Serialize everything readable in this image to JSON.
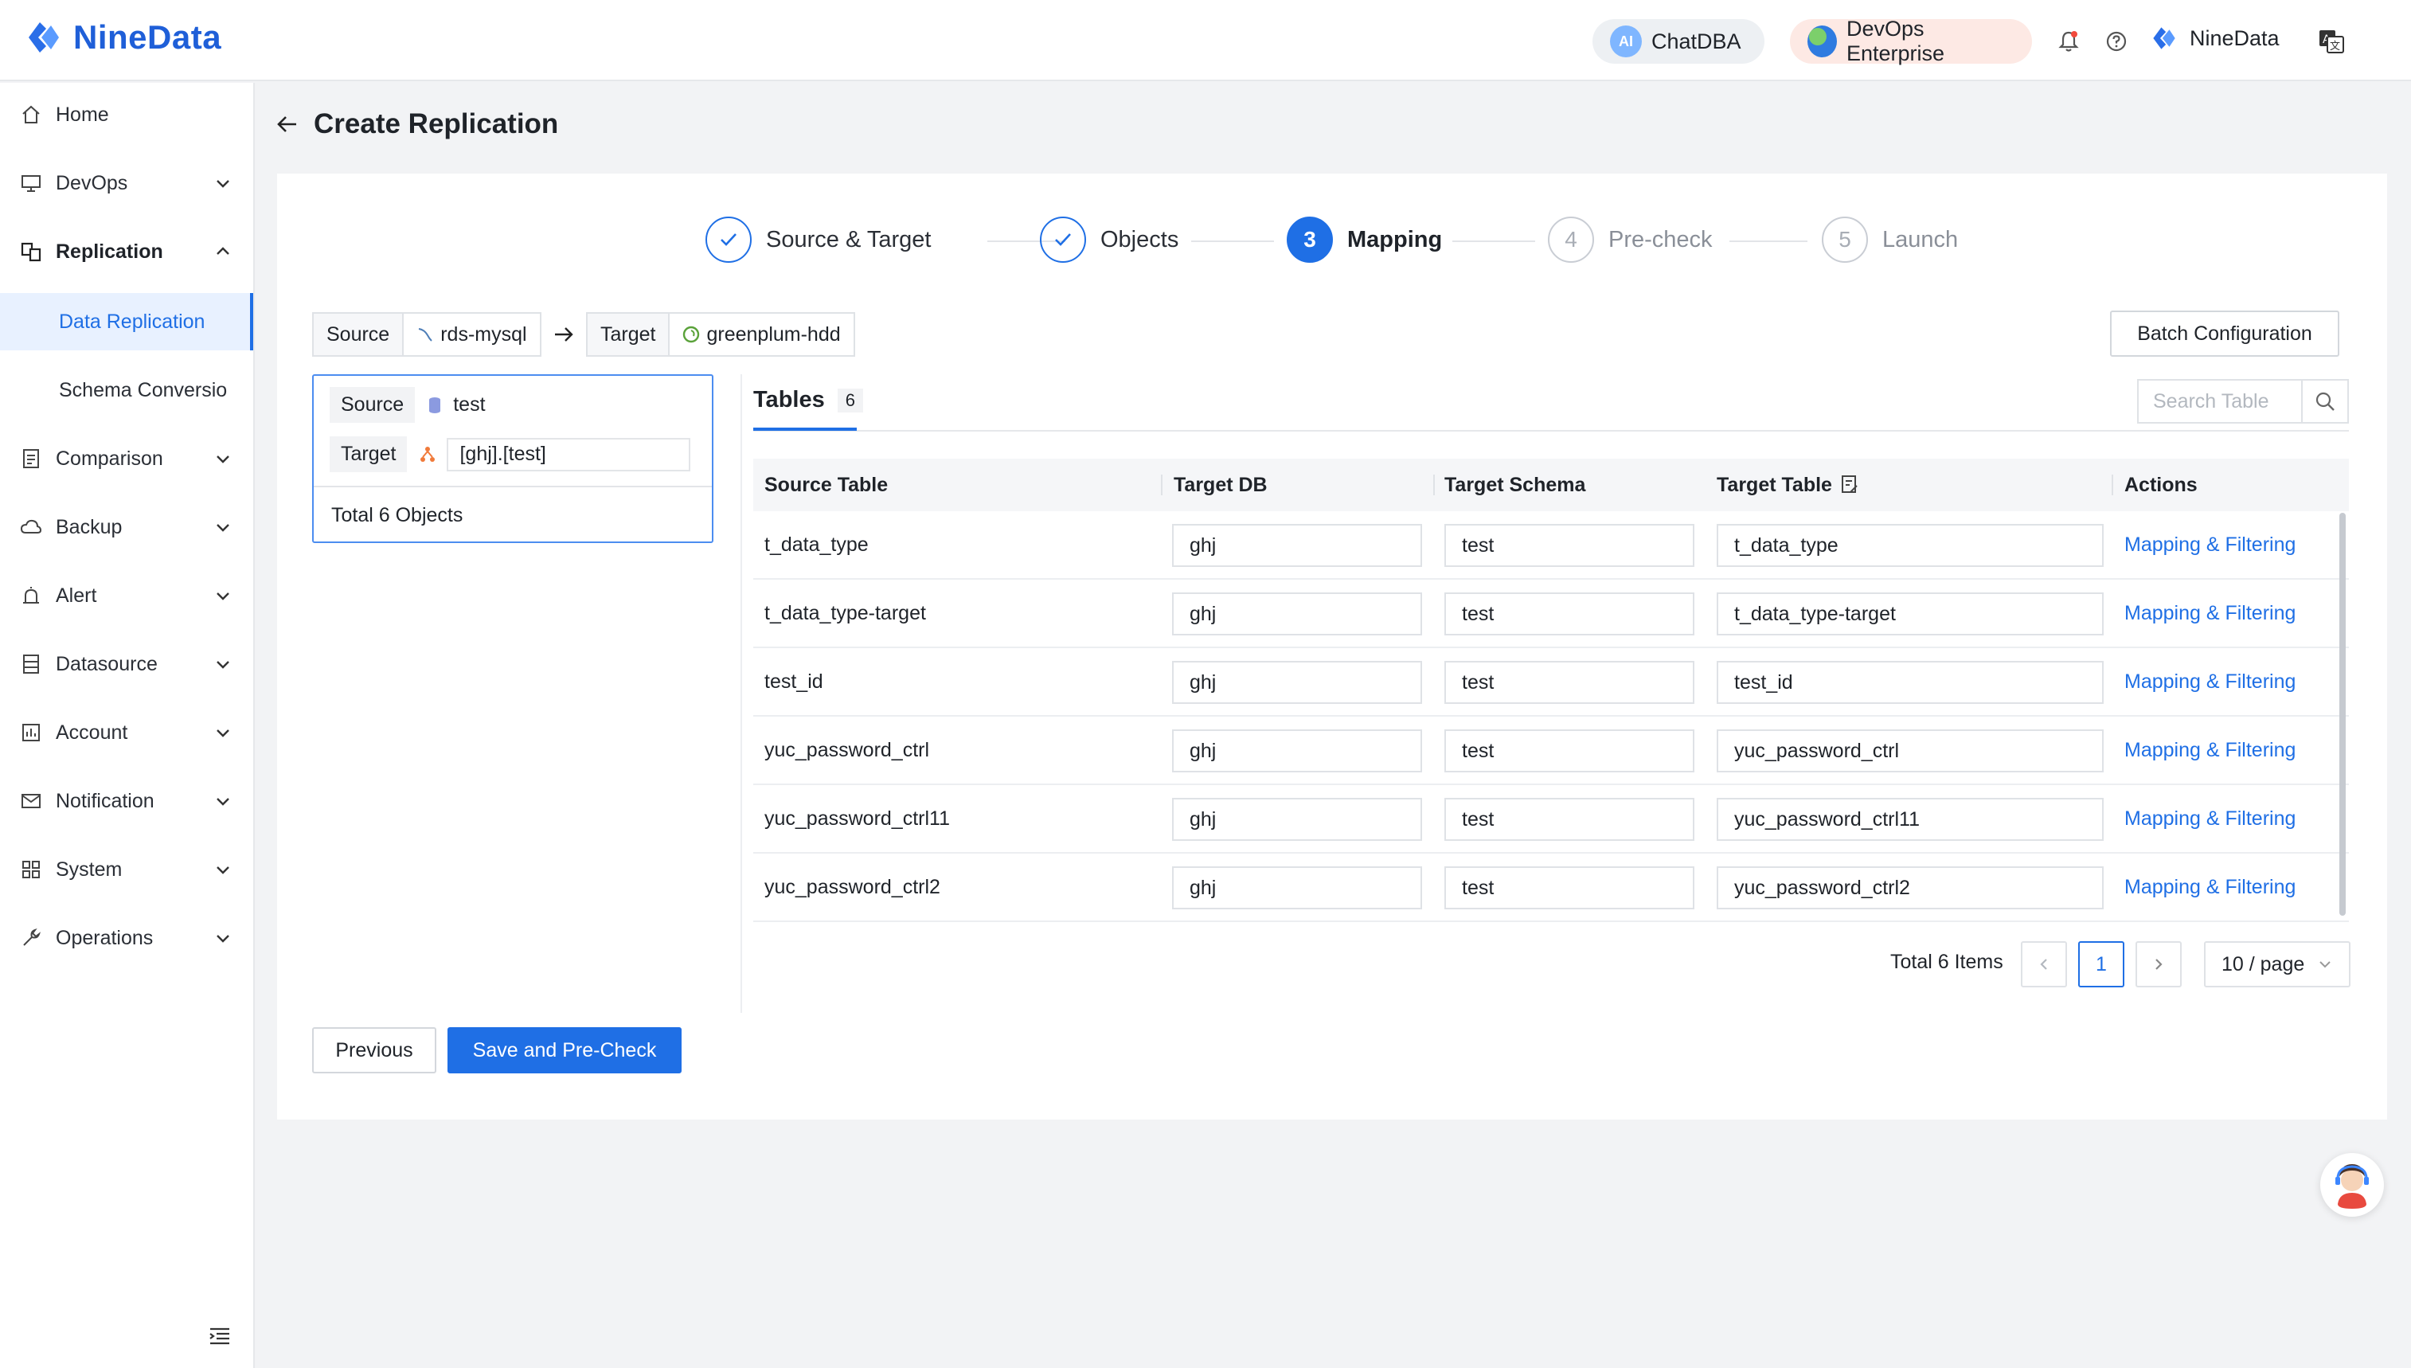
{
  "app": {
    "brand": "NineData"
  },
  "topbar": {
    "chat_label": "ChatDBA",
    "chat_badge": "AI",
    "edition_label": "DevOps Enterprise",
    "user_name": "NineData",
    "icons": [
      "bell-icon",
      "help-icon",
      "language-icon"
    ]
  },
  "sidebar": {
    "home": "Home",
    "devops": "DevOps",
    "replication": "Replication",
    "data_replication": "Data Replication",
    "schema_conversion": "Schema Conversio",
    "comparison": "Comparison",
    "backup": "Backup",
    "alert": "Alert",
    "datasource": "Datasource",
    "account": "Account",
    "notification": "Notification",
    "system": "System",
    "operations": "Operations"
  },
  "page": {
    "title": "Create Replication"
  },
  "steps": [
    {
      "num": "1",
      "label": "Source & Target",
      "state": "done"
    },
    {
      "num": "2",
      "label": "Objects",
      "state": "done"
    },
    {
      "num": "3",
      "label": "Mapping",
      "state": "active"
    },
    {
      "num": "4",
      "label": "Pre-check",
      "state": "todo"
    },
    {
      "num": "5",
      "label": "Launch",
      "state": "todo"
    }
  ],
  "connection": {
    "source_key": "Source",
    "source_value": "rds-mysql",
    "target_key": "Target",
    "target_value": "greenplum-hdd"
  },
  "batch_button": "Batch Configuration",
  "objects": {
    "source_key": "Source",
    "source_value": "test",
    "target_key": "Target",
    "target_value": "[ghj].[test]",
    "total": "Total 6 Objects"
  },
  "tables_tab": {
    "label": "Tables",
    "count": "6"
  },
  "search": {
    "placeholder": "Search Table"
  },
  "table": {
    "headers": [
      "Source Table",
      "Target DB",
      "Target Schema",
      "Target Table",
      "Actions"
    ],
    "rows": [
      {
        "source": "t_data_type",
        "db": "ghj",
        "schema": "test",
        "target": "t_data_type",
        "action": "Mapping & Filtering"
      },
      {
        "source": "t_data_type-target",
        "db": "ghj",
        "schema": "test",
        "target": "t_data_type-target",
        "action": "Mapping & Filtering"
      },
      {
        "source": "test_id",
        "db": "ghj",
        "schema": "test",
        "target": "test_id",
        "action": "Mapping & Filtering"
      },
      {
        "source": "yuc_password_ctrl",
        "db": "ghj",
        "schema": "test",
        "target": "yuc_password_ctrl",
        "action": "Mapping & Filtering"
      },
      {
        "source": "yuc_password_ctrl11",
        "db": "ghj",
        "schema": "test",
        "target": "yuc_password_ctrl11",
        "action": "Mapping & Filtering"
      },
      {
        "source": "yuc_password_ctrl2",
        "db": "ghj",
        "schema": "test",
        "target": "yuc_password_ctrl2",
        "action": "Mapping & Filtering"
      }
    ]
  },
  "pagination": {
    "total": "Total 6 Items",
    "current": "1",
    "page_size": "10 / page"
  },
  "actions": {
    "previous": "Previous",
    "save": "Save and Pre-Check"
  },
  "colors": {
    "primary": "#1f6fe5",
    "brand": "#1f5fd8"
  }
}
